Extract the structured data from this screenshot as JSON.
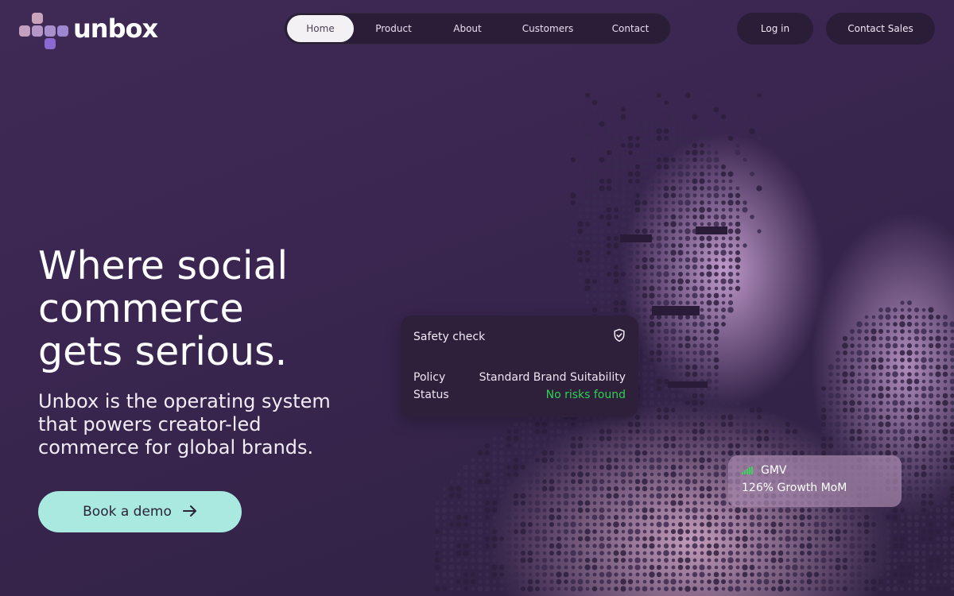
{
  "brand": {
    "name": "unbox",
    "logo_colors": [
      "#c8a3bb",
      "#b497c6",
      "#9f86d0",
      "#8a6ad0"
    ]
  },
  "nav": {
    "items": [
      {
        "label": "Home",
        "active": true
      },
      {
        "label": "Product",
        "active": false
      },
      {
        "label": "About",
        "active": false
      },
      {
        "label": "Customers",
        "active": false
      },
      {
        "label": "Contact",
        "active": false
      }
    ]
  },
  "header": {
    "login_label": "Log in",
    "sales_label": "Contact Sales"
  },
  "hero": {
    "title_line1": "Where social",
    "title_line2": "commerce",
    "title_line3": "gets serious.",
    "subtitle": "Unbox is the operating system that powers creator-led commerce for global brands.",
    "cta_label": "Book a demo"
  },
  "safety_card": {
    "title": "Safety check",
    "icon": "shield-check-icon",
    "rows": [
      {
        "label": "Policy",
        "value": "Standard Brand Suitability"
      },
      {
        "label": "Status",
        "value": "No risks found"
      }
    ],
    "status_color": "#2ed152"
  },
  "gmv_card": {
    "title": "GMV",
    "icon": "signal-bars-icon",
    "subtitle": "126% Growth MoM"
  },
  "colors": {
    "background": "#3a2650",
    "cta": "#a9e9df",
    "pill": "#2a1d38"
  }
}
